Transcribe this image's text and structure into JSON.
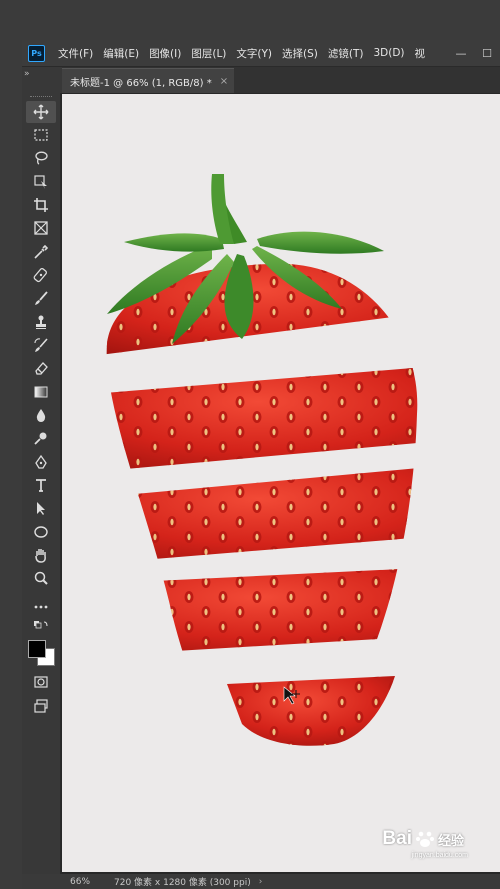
{
  "app": {
    "logo": "Ps"
  },
  "menu": [
    "文件(F)",
    "编辑(E)",
    "图像(I)",
    "图层(L)",
    "文字(Y)",
    "选择(S)",
    "滤镜(T)",
    "3D(D)",
    "视"
  ],
  "window_controls": {
    "minimize": "—",
    "maximize": "☐"
  },
  "panel_collapse": "»",
  "document_tab": {
    "title": "未标题-1 @ 66% (1, RGB/8) *",
    "close": "×"
  },
  "tools": [
    "move-tool",
    "marquee-tool",
    "lasso-tool",
    "object-select-tool",
    "crop-tool",
    "frame-tool",
    "eyedropper-tool",
    "healing-brush-tool",
    "brush-tool",
    "clone-stamp-tool",
    "history-brush-tool",
    "eraser-tool",
    "gradient-tool",
    "blur-tool",
    "dodge-tool",
    "pen-tool",
    "type-tool",
    "path-select-tool",
    "ellipse-tool",
    "hand-tool",
    "zoom-tool",
    "more-tools",
    "swap-colors",
    "foreground-color",
    "quick-mask",
    "screen-mode"
  ],
  "colors": {
    "foreground": "#000000",
    "background": "#ffffff",
    "strawberry_red": "#d8261a",
    "leaf_green": "#3d8a2a"
  },
  "status": {
    "zoom": "66%",
    "dimensions": "720 像素 x 1280 像素 (300 ppi)",
    "arrow": "›"
  },
  "watermark": {
    "brand": "Bai",
    "brand2": "经验",
    "url": "jingyan.baidu.com"
  }
}
